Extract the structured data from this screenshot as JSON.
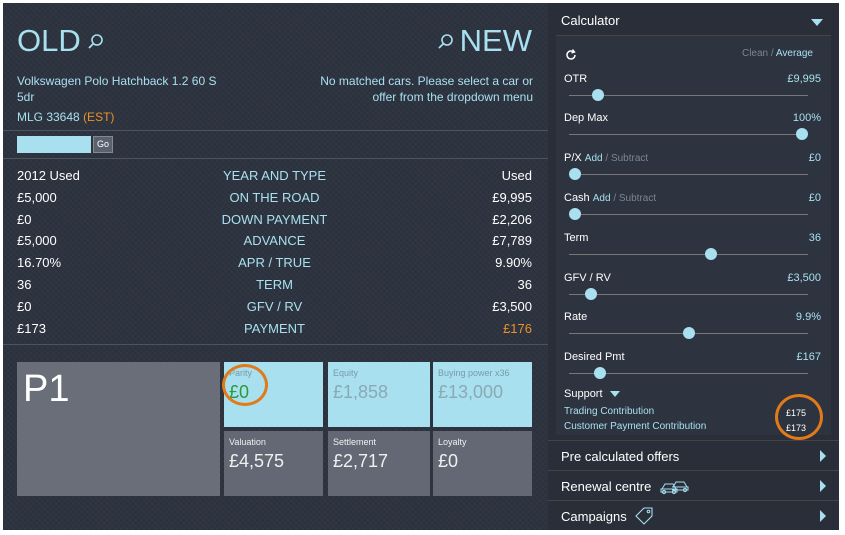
{
  "old": {
    "title": "OLD",
    "car_name": "Volkswagen Polo Hatchback 1.2 60 S 5dr",
    "reg": "MLG 33648",
    "est": "(EST)"
  },
  "new": {
    "title": "NEW",
    "message": "No matched cars. Please select a car or offer from the dropdown menu"
  },
  "search": {
    "placeholder": "",
    "go_label": "Go"
  },
  "comparison": [
    {
      "old": "2012 Used",
      "label": "YEAR AND TYPE",
      "new": "Used"
    },
    {
      "old": "£5,000",
      "label": "ON THE ROAD",
      "new": "£9,995"
    },
    {
      "old": "£0",
      "label": "DOWN PAYMENT",
      "new": "£2,206"
    },
    {
      "old": "£5,000",
      "label": "ADVANCE",
      "new": "£7,789"
    },
    {
      "old": "16.70%",
      "label": "APR / TRUE",
      "new": "9.90%"
    },
    {
      "old": "36",
      "label": "TERM",
      "new": "36"
    },
    {
      "old": "£0",
      "label": "GFV / RV",
      "new": "£3,500"
    },
    {
      "old": "£173",
      "label": "PAYMENT",
      "new": "£176"
    }
  ],
  "tiles": {
    "p1": "P1",
    "parity": {
      "label": "Parity",
      "value": "£0"
    },
    "equity": {
      "label": "Equity",
      "value": "£1,858"
    },
    "buying_power": {
      "label": "Buying power x36",
      "value": "£13,000"
    },
    "valuation": {
      "label": "Valuation",
      "value": "£4,575"
    },
    "settlement": {
      "label": "Settlement",
      "value": "£2,717"
    },
    "loyalty": {
      "label": "Loyalty",
      "value": "£0"
    }
  },
  "calculator": {
    "title": "Calculator",
    "mode_clean": "Clean",
    "mode_sep": "/",
    "mode_average": "Average",
    "sliders": [
      {
        "label": "OTR",
        "value": "£9,995",
        "level": 0.1
      },
      {
        "label": "Dep Max",
        "value": "100%",
        "level": 1.0
      },
      {
        "label": "P/X",
        "add": "Add",
        "sep": "/",
        "subtract": "Subtract",
        "value": "£0",
        "level": 0.0
      },
      {
        "label": "Cash",
        "add": "Add",
        "sep": "/",
        "subtract": "Subtract",
        "value": "£0",
        "level": 0.0
      },
      {
        "label": "Term",
        "value": "36",
        "level": 0.6
      },
      {
        "label": "GFV / RV",
        "value": "£3,500",
        "level": 0.07
      },
      {
        "label": "Rate",
        "value": "9.9%",
        "level": 0.5
      },
      {
        "label": "Desired Pmt",
        "value": "£167",
        "level": 0.11
      }
    ],
    "support": {
      "title": "Support",
      "trading": "Trading Contribution",
      "trading_value": "£175",
      "customer": "Customer Payment Contribution",
      "customer_value": "£173"
    }
  },
  "sections": [
    {
      "label": "Pre calculated offers"
    },
    {
      "label": "Renewal centre"
    },
    {
      "label": "Campaigns"
    }
  ],
  "colors": {
    "accent": "#a8e0f0",
    "highlight": "#e07a1a",
    "parity_green": "#2a9a3a",
    "payment_new": "#e8922a"
  }
}
